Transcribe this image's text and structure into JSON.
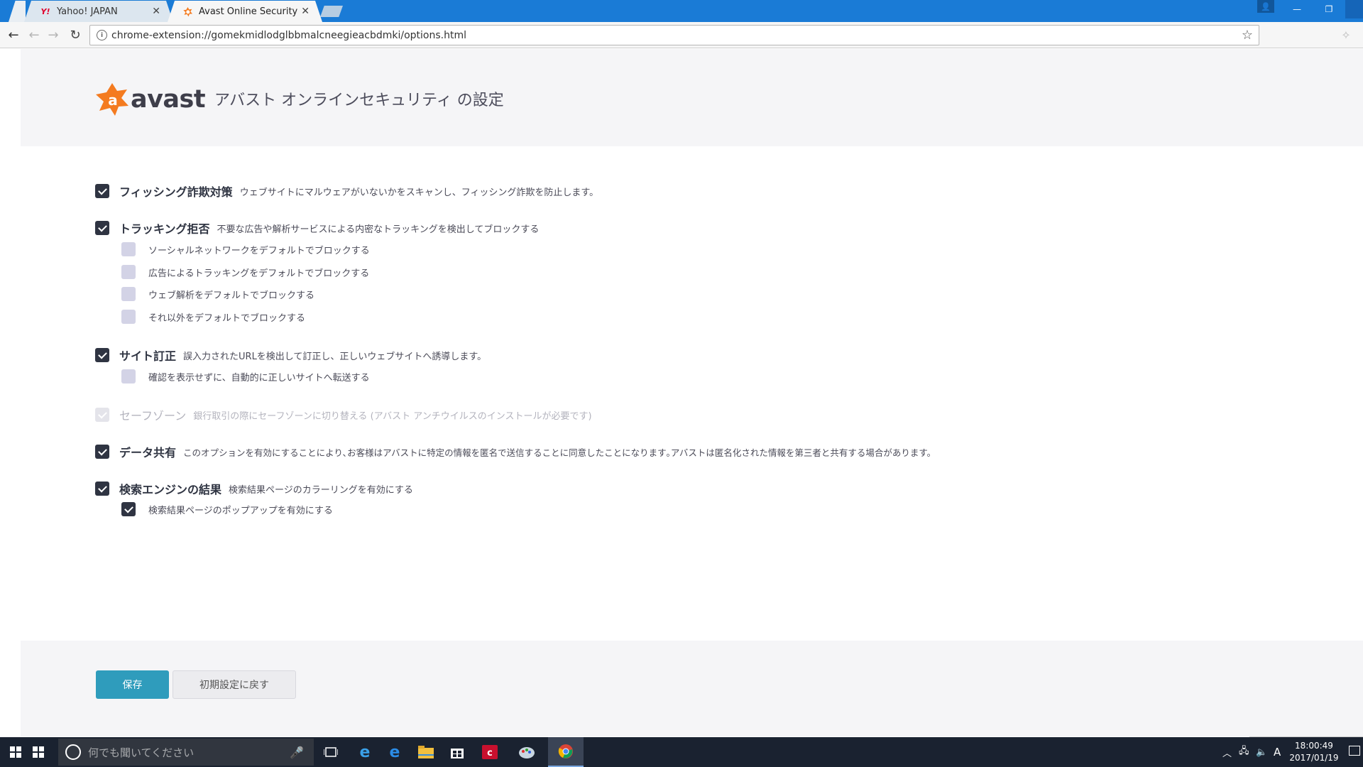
{
  "browser": {
    "tabs": [
      {
        "title": "Yahoo! JAPAN",
        "icon": "yahoo-icon"
      },
      {
        "title": "Avast Online Security",
        "icon": "avast-icon"
      }
    ],
    "url": "chrome-extension://gomekmidlodglbbmalcneegieacbdmki/options.html"
  },
  "header": {
    "logo_text": "avast",
    "title": "アバスト オンラインセキュリティ の設定"
  },
  "settings": [
    {
      "id": "phishing",
      "label": "フィッシング詐欺対策",
      "desc": "ウェブサイトにマルウェアがいないかをスキャンし、フィッシング詐欺を防止します。",
      "checked": true
    },
    {
      "id": "tracking",
      "label": "トラッキング拒否",
      "desc": "不要な広告や解析サービスによる内密なトラッキングを検出してブロックする",
      "checked": true,
      "sub": [
        {
          "label": "ソーシャルネットワークをデフォルトでブロックする",
          "checked": false
        },
        {
          "label": "広告によるトラッキングをデフォルトでブロックする",
          "checked": false
        },
        {
          "label": "ウェブ解析をデフォルトでブロックする",
          "checked": false
        },
        {
          "label": "それ以外をデフォルトでブロックする",
          "checked": false
        }
      ]
    },
    {
      "id": "sitecorrect",
      "label": "サイト訂正",
      "desc": "誤入力されたURLを検出して訂正し、正しいウェブサイトへ誘導します。",
      "checked": true,
      "sub": [
        {
          "label": "確認を表示せずに、自動的に正しいサイトへ転送する",
          "checked": false
        }
      ]
    },
    {
      "id": "safezone",
      "label": "セーフゾーン",
      "desc": "銀行取引の際にセーフゾーンに切り替える (アバスト アンチウイルスのインストールが必要です)",
      "checked": true,
      "disabled": true
    },
    {
      "id": "datashare",
      "label": "データ共有",
      "desc": "このオプションを有効にすることにより､お客様はアバストに特定の情報を匿名で送信することに同意したことになります｡アバストは匿名化された情報を第三者と共有する場合があります。",
      "checked": true
    },
    {
      "id": "search",
      "label": "検索エンジンの結果",
      "desc": "検索結果ページのカラーリングを有効にする",
      "checked": true,
      "sub": [
        {
          "label": "検索結果ページのポップアップを有効にする",
          "checked": true
        }
      ]
    }
  ],
  "footer": {
    "save_label": "保存",
    "reset_label": "初期設定に戻す"
  },
  "taskbar": {
    "search_placeholder": "何でも聞いてください",
    "ime": "A",
    "time": "18:00:49",
    "date": "2017/01/19"
  },
  "colors": {
    "accent_orange": "#f47b20",
    "button_blue": "#2f9cbc",
    "checkbox_dark": "#2f3442",
    "titlebar_blue": "#1a7bd6"
  }
}
